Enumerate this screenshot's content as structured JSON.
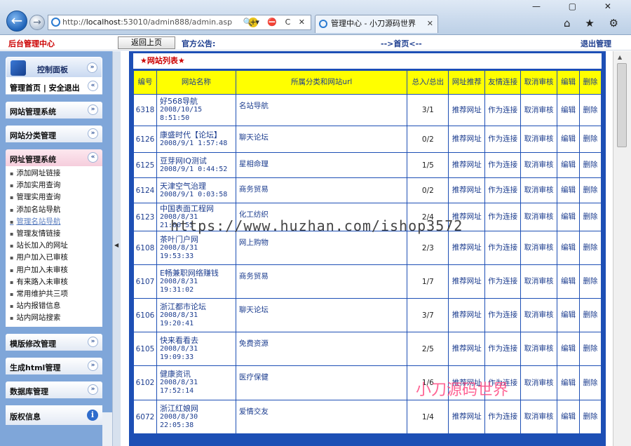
{
  "browser": {
    "address": "http://localhost:53010/admin888/admin.asp",
    "address_prefix": "http://",
    "address_host": "localhost",
    "address_rest": ":53010/admin888/admin.asp",
    "tab_title": "管理中心 - 小刀源码世界",
    "back_glyph": "←",
    "fwd_glyph": "→",
    "addr_tools": "🔍▾ ⛔ C ✕",
    "tab_close": "✕",
    "win_buttons": "— ▢ ✕",
    "chrome_icons": "⌂ ★ ⚙"
  },
  "topbar": {
    "admin_title": "后台管理中心",
    "back_button": "返回上页",
    "notice": "官方公告:",
    "home_link": "-->首页<--",
    "logout": "退出管理"
  },
  "sidebar": {
    "panel_title": "控制面板",
    "home": "管理首页 | 安全退出",
    "groups": [
      {
        "label": "网站管理系统"
      },
      {
        "label": "网站分类管理"
      },
      {
        "label": "网址管理系统"
      }
    ],
    "items": [
      "添加网址链接",
      "添加实用查询",
      "管理实用查询",
      "添加名站导航",
      "管理名站导航",
      "管理友情链接",
      "站长加入的网址",
      "用户加入已审核",
      "用户加入未审核",
      "有来路入未审核",
      "常用维护共三项",
      "站内报错信息",
      "站内网站搜索"
    ],
    "groups_after": [
      {
        "label": "模版修改管理"
      },
      {
        "label": "生成html管理"
      },
      {
        "label": "数据库管理"
      }
    ],
    "copyright": "版权信息",
    "chev_down": "»",
    "chev_up": "«"
  },
  "main": {
    "list_title": "★网站列表★",
    "headers": [
      "编号",
      "网站名称",
      "所属分类和网站url",
      "总入/总出",
      "网址推荐",
      "友情连接",
      "取消审核",
      "编辑",
      "删除"
    ],
    "rows": [
      {
        "id": "6318",
        "name": "好568导航",
        "date": "2008/10/15 8:51:50",
        "cat": "名站导航",
        "count": "3/1"
      },
      {
        "id": "6126",
        "name": "康盛时代【论坛】",
        "date": "2008/9/1 1:57:48",
        "cat": "聊天论坛",
        "count": "0/2"
      },
      {
        "id": "6125",
        "name": "豆芽网IQ测试",
        "date": "2008/9/1 0:44:52",
        "cat": "星相命理",
        "count": "1/5"
      },
      {
        "id": "6124",
        "name": "天津空气治理",
        "date": "2008/9/1 0:03:58",
        "cat": "商务贸易",
        "count": "0/2"
      },
      {
        "id": "6123",
        "name": "中国表面工程网",
        "date": "2008/8/31 21:00:53",
        "cat": "化工纺织",
        "count": "2/4"
      },
      {
        "id": "6108",
        "name": "茶叶门户网",
        "date": "2008/8/31 19:53:33",
        "cat": "网上购物",
        "count": "2/3"
      },
      {
        "id": "6107",
        "name": "E畅兼职网络赚钱",
        "date": "2008/8/31 19:31:02",
        "cat": "商务贸易",
        "count": "1/7"
      },
      {
        "id": "6106",
        "name": "浙江都市论坛",
        "date": "2008/8/31 19:20:41",
        "cat": "聊天论坛",
        "count": "3/7"
      },
      {
        "id": "6105",
        "name": "快来看看去",
        "date": "2008/8/31 19:09:33",
        "cat": "免费资源",
        "count": "2/5"
      },
      {
        "id": "6102",
        "name": "健康资讯",
        "date": "2008/8/31 17:52:14",
        "cat": "医疗保健",
        "count": "1/6"
      },
      {
        "id": "6072",
        "name": "浙江红娘网",
        "date": "2008/8/30 22:05:38",
        "cat": "爱情交友",
        "count": "1/4"
      }
    ],
    "actions": {
      "recommend": "推荐网址",
      "friend": "作为连接",
      "cancel": "取消审核",
      "edit": "编辑",
      "delete": "删除"
    }
  },
  "watermarks": {
    "url": "https://www.huzhan.com/ishop3572",
    "brand": "小刀源码世界"
  }
}
